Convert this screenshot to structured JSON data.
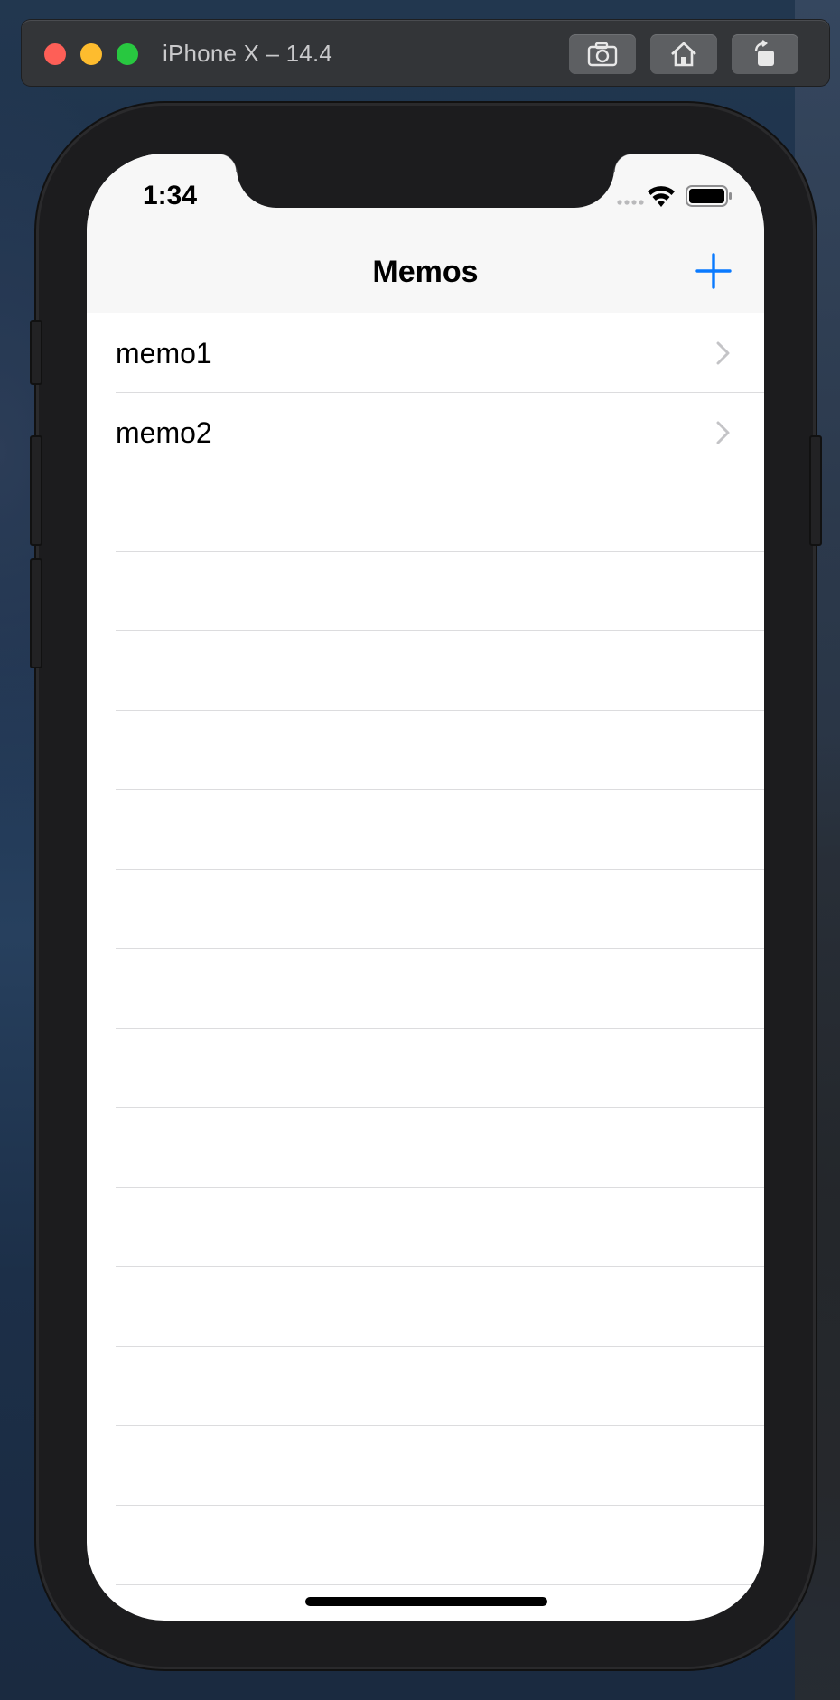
{
  "simulator": {
    "title": "iPhone X – 14.4",
    "buttons": [
      {
        "name": "screenshot",
        "icon": "camera-icon"
      },
      {
        "name": "home",
        "icon": "house-icon"
      },
      {
        "name": "rotate",
        "icon": "rotate-icon"
      }
    ]
  },
  "status_bar": {
    "time": "1:34",
    "icons": [
      "signal-icon",
      "wifi-icon",
      "battery-icon"
    ]
  },
  "nav_bar": {
    "title": "Memos",
    "add_icon": "plus-icon"
  },
  "memos": [
    {
      "label": "memo1"
    },
    {
      "label": "memo2"
    }
  ],
  "colors": {
    "accent": "#0a7aff",
    "nav_background": "#f7f7f7",
    "separator": "#dcdcde",
    "chevron": "#c4c4c7"
  }
}
